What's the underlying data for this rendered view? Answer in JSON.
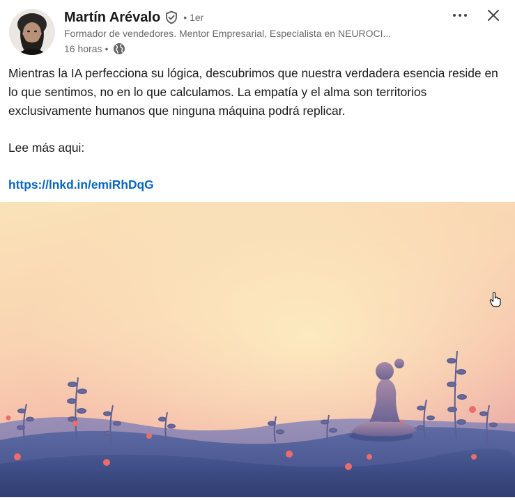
{
  "post": {
    "author": {
      "name": "Martín Arévalo",
      "degree": "1er",
      "headline": "Formador de vendedores. Mentor Empresarial, Especialista en NEUROCI...",
      "time": "16 horas",
      "separator": "•"
    },
    "icons": {
      "verified": "shield-check-icon",
      "visibility": "globe-icon",
      "more": "ellipsis-icon",
      "close": "close-icon",
      "cursor": "hand-pointer-icon"
    },
    "text": {
      "paragraph": "Mientras la IA perfecciona su lógica, descubrimos que nuestra verdadera esencia reside en lo que sentimos, no en lo que calculamos. La empatía y el alma son territorios exclusivamente humanos que ninguna máquina podrá replicar.",
      "read_more": "Lee más aqui:",
      "link": "https://lnkd.in/emiRhDqG"
    },
    "image": {
      "subject": "woman-meditating-sunset-illustration",
      "colors": {
        "sky_top": "#f9dfb4",
        "sky_bottom": "#f6b6a0",
        "hills": "#4a5a92",
        "flowers": "#ea6c6c"
      }
    },
    "colors": {
      "link": "#0a66c2",
      "text": "#1f1f1f",
      "muted": "#666666"
    }
  }
}
